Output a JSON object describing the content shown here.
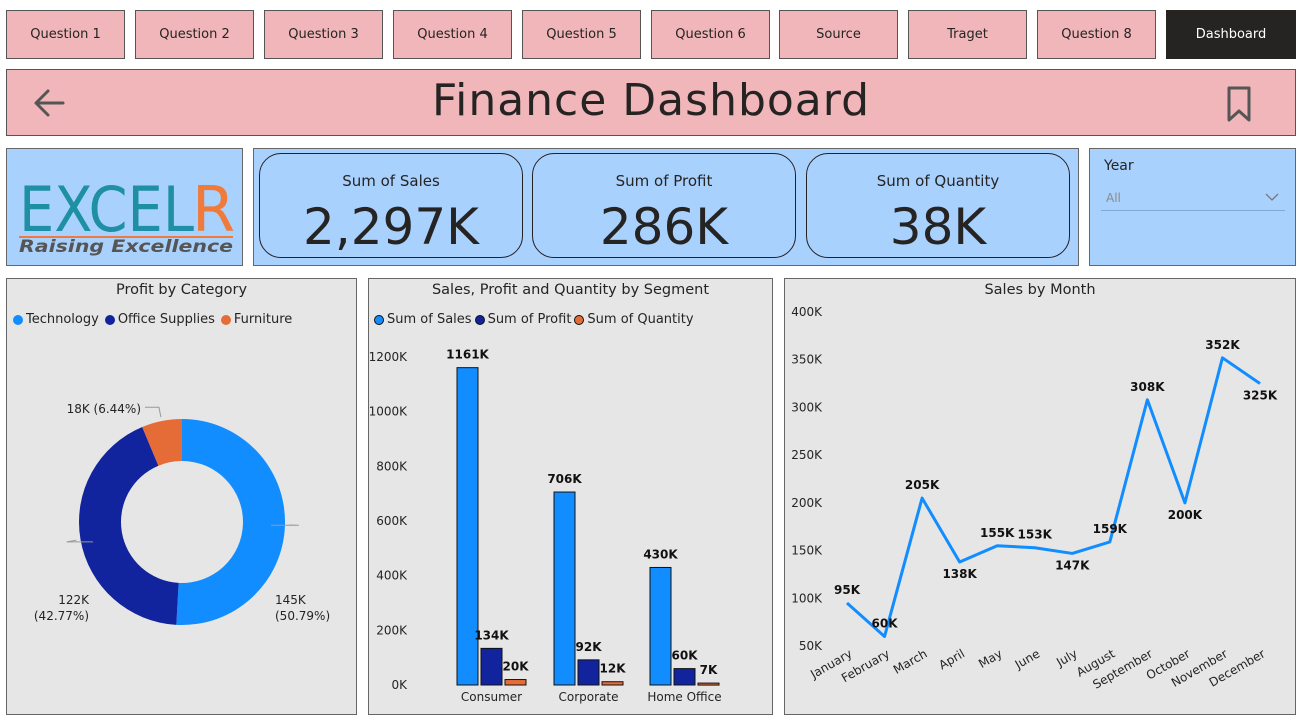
{
  "nav": {
    "tabs": [
      {
        "label": "Question 1",
        "active": false
      },
      {
        "label": "Question 2",
        "active": false
      },
      {
        "label": "Question 3",
        "active": false
      },
      {
        "label": "Question 4",
        "active": false
      },
      {
        "label": "Question 5",
        "active": false
      },
      {
        "label": "Question 6",
        "active": false
      },
      {
        "label": "Source",
        "active": false
      },
      {
        "label": "Traget",
        "active": false
      },
      {
        "label": "Question 8",
        "active": false
      },
      {
        "label": "Dashboard",
        "active": true
      }
    ]
  },
  "header": {
    "title": "Finance Dashboard",
    "back_icon": "back-arrow-icon",
    "bookmark_icon": "bookmark-icon"
  },
  "logo": {
    "brand": "EXCELR",
    "tagline": "Raising Excellence",
    "colors": {
      "primary": "#1f8fa6",
      "accent": "#f07a3a",
      "tagline": "#555555"
    }
  },
  "kpis": [
    {
      "label": "Sum of Sales",
      "value": "2,297K"
    },
    {
      "label": "Sum of Profit",
      "value": "286K"
    },
    {
      "label": "Sum of Quantity",
      "value": "38K"
    }
  ],
  "slicer": {
    "label": "Year",
    "selected": "All",
    "icon": "chevron-down-icon"
  },
  "colors": {
    "tab_bg": "#f0b6b9",
    "tab_active": "#252423",
    "kpi_bg": "#a9d1fe",
    "panel_bg": "#e6e6e6",
    "technology": "#118dff",
    "office_supplies": "#12239e",
    "furniture": "#e66c37"
  },
  "chart_data": [
    {
      "type": "pie",
      "variant": "donut",
      "title": "Profit by Category",
      "legend_position": "top-left",
      "categories": [
        "Technology",
        "Office Supplies",
        "Furniture"
      ],
      "values": [
        145,
        122,
        18
      ],
      "percent": [
        50.79,
        42.77,
        6.44
      ],
      "data_labels": [
        "145K (50.79%)",
        "122K (42.77%)",
        "18K (6.44%)"
      ],
      "colors": [
        "#118dff",
        "#12239e",
        "#e66c37"
      ]
    },
    {
      "type": "bar",
      "title": "Sales, Profit and Quantity by Segment",
      "legend_position": "top-left",
      "categories": [
        "Consumer",
        "Corporate",
        "Home Office"
      ],
      "series": [
        {
          "name": "Sum of Sales",
          "values": [
            1161,
            706,
            430
          ],
          "labels": [
            "1161K",
            "706K",
            "430K"
          ],
          "color": "#118dff"
        },
        {
          "name": "Sum of Profit",
          "values": [
            134,
            92,
            60
          ],
          "labels": [
            "134K",
            "92K",
            "60K"
          ],
          "color": "#12239e"
        },
        {
          "name": "Sum of Quantity",
          "values": [
            20,
            12,
            7
          ],
          "labels": [
            "20K",
            "12K",
            "7K"
          ],
          "color": "#e66c37"
        }
      ],
      "ylim": [
        0,
        1200
      ],
      "yticks": [
        0,
        200,
        400,
        600,
        800,
        1000,
        1200
      ],
      "ytick_labels": [
        "0K",
        "200K",
        "400K",
        "600K",
        "800K",
        "1000K",
        "1200K"
      ],
      "grid": false
    },
    {
      "type": "line",
      "title": "Sales by Month",
      "categories": [
        "January",
        "February",
        "March",
        "April",
        "May",
        "June",
        "July",
        "August",
        "September",
        "October",
        "November",
        "December"
      ],
      "series": [
        {
          "values": [
            95,
            60,
            205,
            138,
            155,
            153,
            147,
            159,
            308,
            200,
            352,
            325
          ],
          "labels": [
            "95K",
            "60K",
            "205K",
            "138K",
            "155K",
            "153K",
            "147K",
            "159K",
            "308K",
            "200K",
            "352K",
            "325K"
          ],
          "color": "#118dff"
        }
      ],
      "ylim": [
        50,
        400
      ],
      "yticks": [
        50,
        100,
        150,
        200,
        250,
        300,
        350,
        400
      ],
      "ytick_labels": [
        "50K",
        "100K",
        "150K",
        "200K",
        "250K",
        "300K",
        "350K",
        "400K"
      ],
      "grid": false
    }
  ]
}
